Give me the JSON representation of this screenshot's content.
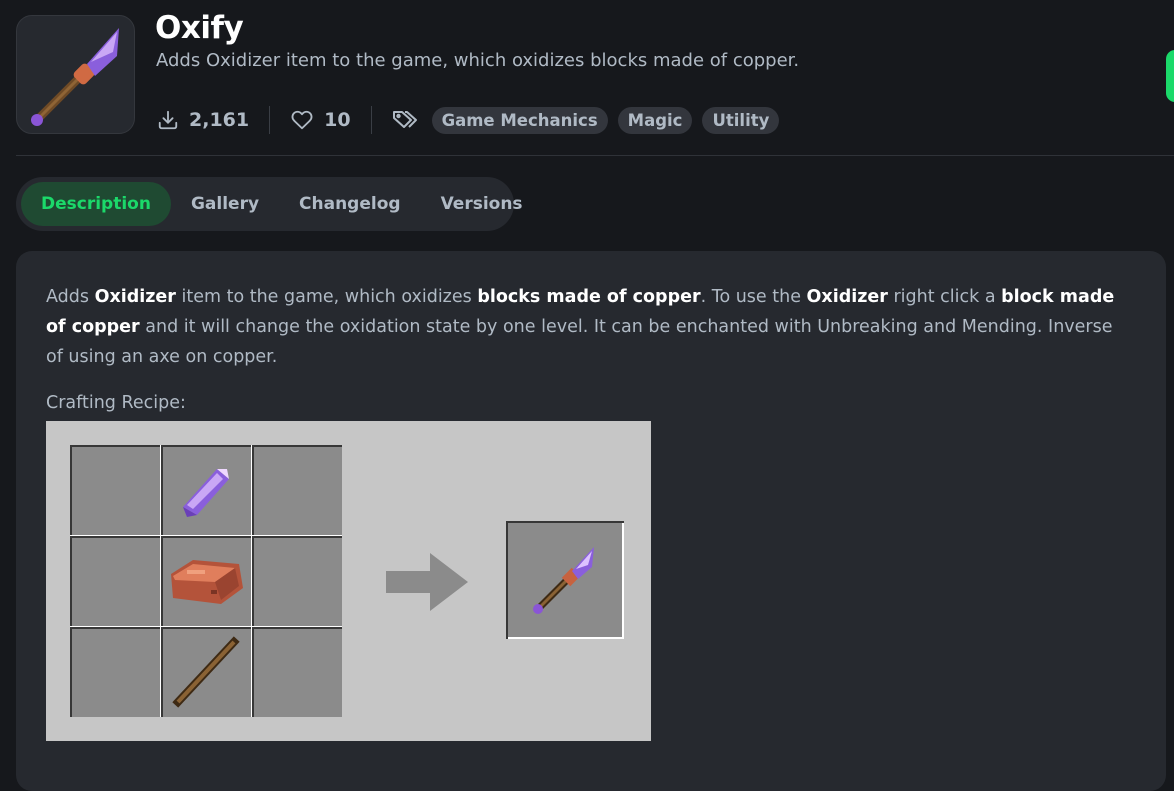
{
  "project": {
    "title": "Oxify",
    "summary": "Adds Oxidizer item to the game, which oxidizes blocks made of copper.",
    "downloads": "2,161",
    "follows": "10",
    "tags": [
      "Game Mechanics",
      "Magic",
      "Utility"
    ]
  },
  "tabs": {
    "description": "Description",
    "gallery": "Gallery",
    "changelog": "Changelog",
    "versions": "Versions"
  },
  "description": {
    "p1": "Adds ",
    "b1": "Oxidizer",
    "p2": " item to the game, which oxidizes ",
    "b2": "blocks made of copper",
    "p3": ". To use the ",
    "b3": "Oxidizer",
    "p4": " right click a ",
    "b4": "block made of copper",
    "p5": " and it will change the oxidation state by one level. It can be enchanted with Unbreaking and Mending. Inverse of using an axe on copper.",
    "recipe_label": "Crafting Recipe:"
  },
  "recipe": {
    "slots": [
      "",
      "amethyst-shard-icon",
      "",
      "",
      "copper-ingot-icon",
      "",
      "",
      "stick-icon",
      ""
    ],
    "result": "oxidizer-icon"
  },
  "colors": {
    "accent": "#1bd96a",
    "background": "#16181c",
    "card": "#26292f"
  }
}
